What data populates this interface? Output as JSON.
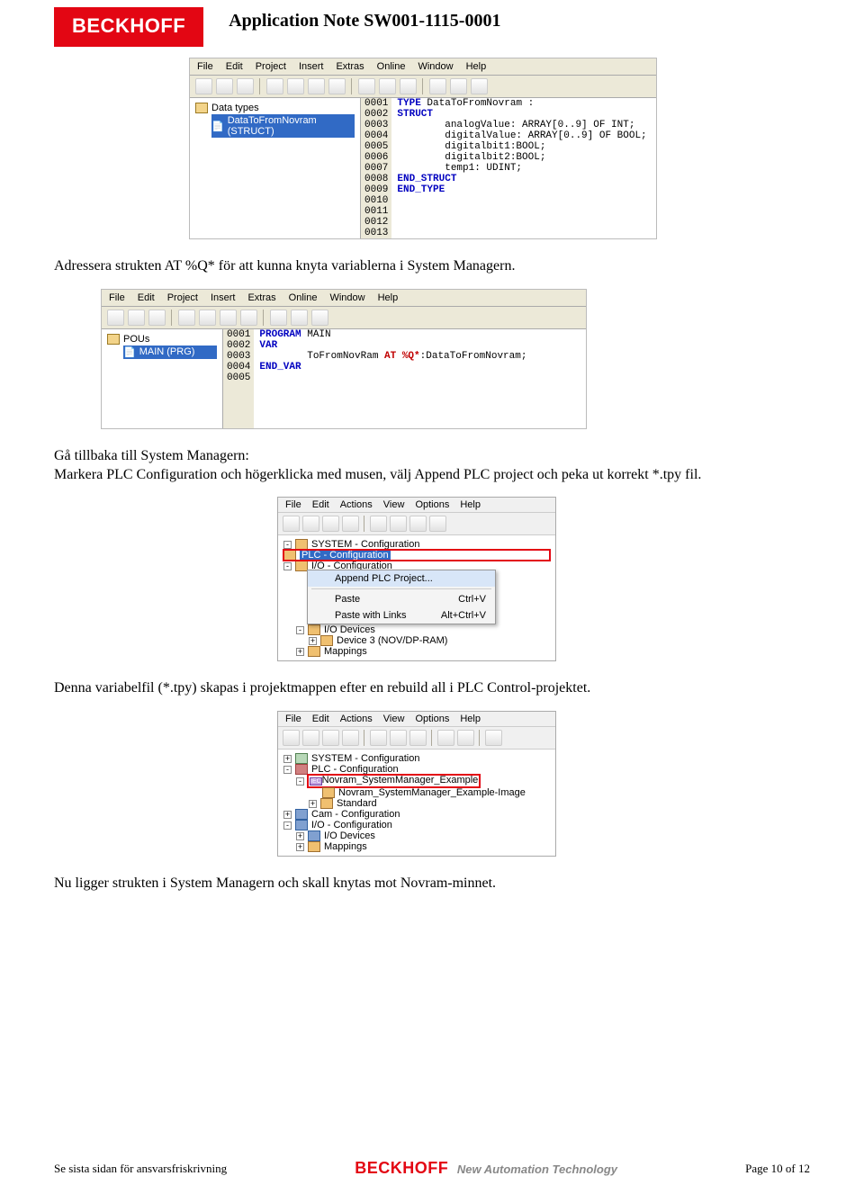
{
  "header": {
    "logo": "BECKHOFF",
    "title": "Application Note SW001-1115-0001"
  },
  "shot1": {
    "menu": [
      "File",
      "Edit",
      "Project",
      "Insert",
      "Extras",
      "Online",
      "Window",
      "Help"
    ],
    "tree_root": "Data types",
    "tree_item": "DataToFromNovram (STRUCT)",
    "gutter": "0001\n0002\n0003\n0004\n0005\n0006\n0007\n0008\n0009\n0010\n0011\n0012\n0013",
    "code": [
      {
        "kw": "TYPE ",
        "txt": "DataToFromNovram :"
      },
      {
        "kw": "STRUCT",
        "txt": ""
      },
      {
        "kw": "",
        "txt": "        analogValue: ARRAY[0..9] OF INT;"
      },
      {
        "kw": "",
        "txt": "        digitalValue: ARRAY[0..9] OF BOOL;"
      },
      {
        "kw": "",
        "txt": "        digitalbit1:BOOL;"
      },
      {
        "kw": "",
        "txt": "        digitalbit2:BOOL;"
      },
      {
        "kw": "",
        "txt": "        temp1: UDINT;"
      },
      {
        "kw": "END_STRUCT",
        "txt": ""
      },
      {
        "kw": "END_TYPE",
        "txt": ""
      }
    ]
  },
  "para1": "Adressera strukten AT %Q* för att kunna knyta variablerna i System Managern.",
  "shot2": {
    "menu": [
      "File",
      "Edit",
      "Project",
      "Insert",
      "Extras",
      "Online",
      "Window",
      "Help"
    ],
    "tree_root": "POUs",
    "tree_item": "MAIN (PRG)",
    "gutter": "0001\n0002\n0003\n0004\n0005",
    "code": [
      {
        "kw": "PROGRAM ",
        "txt": "MAIN",
        "extra": ""
      },
      {
        "kw": "VAR",
        "txt": ""
      },
      {
        "kw": "",
        "txt": "        ToFromNovRam ",
        "at": "AT %Q*",
        ":": ":DataToFromNovram;"
      },
      {
        "kw": "END_VAR",
        "txt": ""
      }
    ]
  },
  "para2": "Gå tillbaka till System Managern:\nMarkera PLC Configuration och högerklicka med musen, välj Append PLC project och peka ut korrekt *.tpy fil.",
  "shot3": {
    "menu": [
      "File",
      "Edit",
      "Actions",
      "View",
      "Options",
      "Help"
    ],
    "tree": [
      {
        "lvl": 0,
        "exp": "-",
        "t": "SYSTEM - Configuration"
      },
      {
        "lvl": 0,
        "exp": "",
        "t": "PLC - Configuration",
        "red": true,
        "sel": true
      },
      {
        "lvl": 0,
        "exp": "-",
        "t": "I/O - Configuration"
      }
    ],
    "ctx": {
      "append": "Append PLC Project...",
      "paste": "Paste",
      "paste_k": "Ctrl+V",
      "pastelinks": "Paste with Links",
      "pastelinks_k": "Alt+Ctrl+V"
    },
    "rows_below": [
      {
        "lvl": 1,
        "t": "I/O Devices",
        "exp": "-"
      },
      {
        "lvl": 2,
        "t": "Device 3 (NOV/DP-RAM)",
        "exp": "+"
      },
      {
        "lvl": 1,
        "t": "Mappings",
        "exp": "+"
      }
    ]
  },
  "para3": "Denna variabelfil (*.tpy) skapas i projektmappen efter en rebuild all i PLC Control-projektet.",
  "shot4": {
    "menu": [
      "File",
      "Edit",
      "Actions",
      "View",
      "Options",
      "Help"
    ],
    "tree": [
      {
        "lvl": 0,
        "exp": "+",
        "t": "SYSTEM - Configuration",
        "cls": "cfg"
      },
      {
        "lvl": 0,
        "exp": "-",
        "t": "PLC - Configuration",
        "cls": "plc"
      },
      {
        "lvl": 1,
        "exp": "-",
        "t": "Novram_SystemManager_Example",
        "cls": "iec",
        "red": true
      },
      {
        "lvl": 2,
        "exp": "",
        "t": "Novram_SystemManager_Example-Image",
        "cls": ""
      },
      {
        "lvl": 2,
        "exp": "+",
        "t": "Standard",
        "cls": ""
      },
      {
        "lvl": 0,
        "exp": "+",
        "t": "Cam - Configuration",
        "cls": "io"
      },
      {
        "lvl": 0,
        "exp": "-",
        "t": "I/O - Configuration",
        "cls": "io"
      },
      {
        "lvl": 1,
        "exp": "+",
        "t": "I/O Devices",
        "cls": "io"
      },
      {
        "lvl": 1,
        "exp": "+",
        "t": "Mappings",
        "cls": ""
      }
    ]
  },
  "para4": "Nu ligger strukten i System Managern och skall knytas mot Novram-minnet.",
  "footer": {
    "left": "Se sista sidan för ansvarsfriskrivning",
    "brand": "BECKHOFF",
    "tagline": "New Automation Technology",
    "right": "Page 10 of 12"
  }
}
